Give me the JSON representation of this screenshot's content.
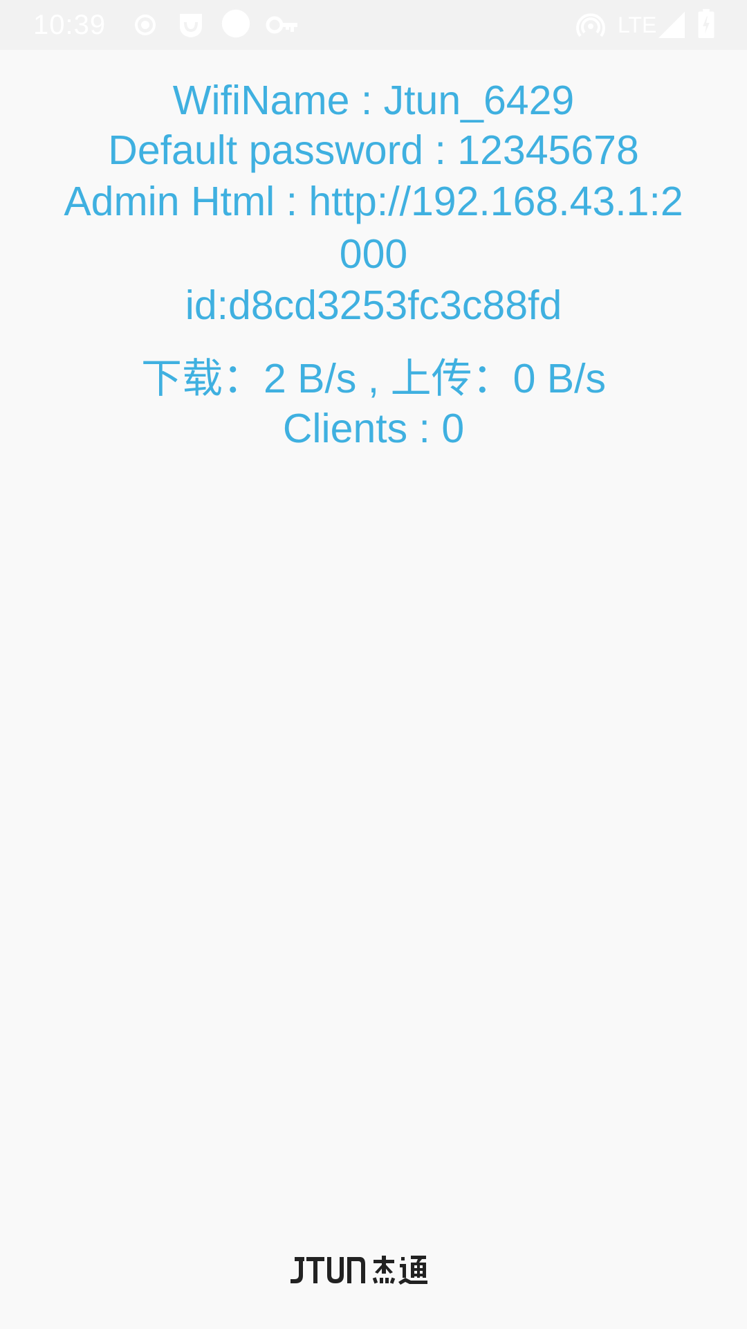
{
  "status_bar": {
    "time": "10:39",
    "network": "LTE",
    "icons": [
      "record-icon",
      "notification-app-icon",
      "circle-icon",
      "vpn-key-icon",
      "hotspot-icon",
      "signal-icon",
      "battery-icon"
    ],
    "icon_color": "#ffffff"
  },
  "info": {
    "wifi_name": "WifiName : Jtun_6429",
    "password": "Default password : 12345678",
    "admin_html": "Admin Html : http://192.168.43.1:2000",
    "id": "id:d8cd3253fc3c88fd",
    "speed": "下载：2 B/s , 上传：0 B/s",
    "clients": "Clients : 0"
  },
  "brand": {
    "logo_text": "JTUn 杰通",
    "text_color": "#3fb0e0"
  }
}
